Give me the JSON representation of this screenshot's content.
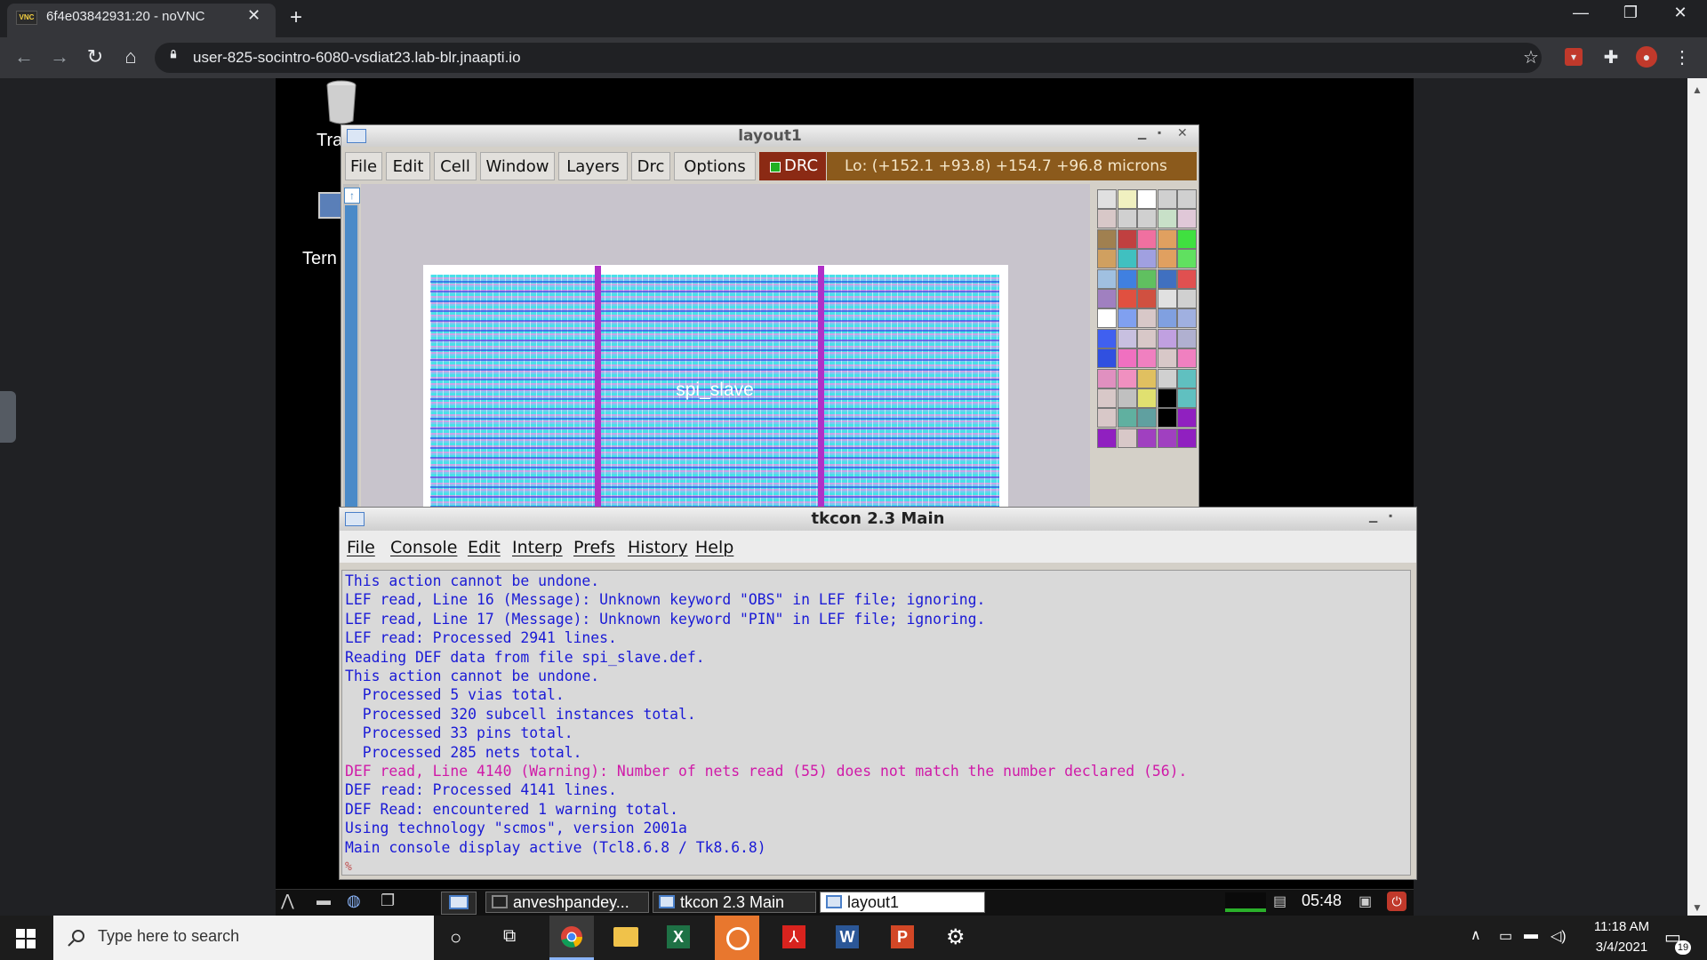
{
  "browser": {
    "tab_title": "6f4e03842931:20 - noVNC",
    "tab_icon_text": "VNC",
    "url": "user-825-socintro-6080-vsdiat23.lab-blr.jnaapti.io"
  },
  "desktop": {
    "trash_label": "Tra",
    "terminal_label": "Tern"
  },
  "layout_window": {
    "title": "layout1",
    "menu": [
      "File",
      "Edit",
      "Cell",
      "Window",
      "Layers",
      "Drc",
      "Options"
    ],
    "drc_label": "DRC",
    "coords": "Lo:   (+152.1 +93.8) +154.7 +96.8 microns",
    "cell_label": "spi_slave"
  },
  "tkcon": {
    "title": "tkcon 2.3 Main",
    "menu": [
      "File",
      "Console",
      "Edit",
      "Interp",
      "Prefs",
      "History",
      "Help"
    ],
    "lines": [
      "This action cannot be undone.",
      "LEF read, Line 16 (Message): Unknown keyword \"OBS\" in LEF file; ignoring.",
      "LEF read, Line 17 (Message): Unknown keyword \"PIN\" in LEF file; ignoring.",
      "LEF read: Processed 2941 lines.",
      "Reading DEF data from file spi_slave.def.",
      "This action cannot be undone.",
      "  Processed 5 vias total.",
      "  Processed 320 subcell instances total.",
      "  Processed 33 pins total.",
      "  Processed 285 nets total.",
      "DEF read, Line 4140 (Warning): Number of nets read (55) does not match the number declared (56).",
      "DEF read: Processed 4141 lines.",
      "DEF Read: encountered 1 warning total.",
      "Using technology \"scmos\", version 2001a",
      "Main console display active (Tcl8.6.8 / Tk8.6.8)"
    ],
    "prompt": "%"
  },
  "lx_panel": {
    "tasks": [
      "anveshpandey...",
      "tkcon 2.3 Main",
      "layout1"
    ],
    "clock": "05:48"
  },
  "taskbar": {
    "search_placeholder": "Type here to search",
    "time": "11:18 AM",
    "date": "3/4/2021",
    "notifications": "19"
  },
  "colors": {
    "console_text": "#1a1ad6",
    "console_warning": "#d01aa8",
    "drc_button": "#8b2a14"
  }
}
